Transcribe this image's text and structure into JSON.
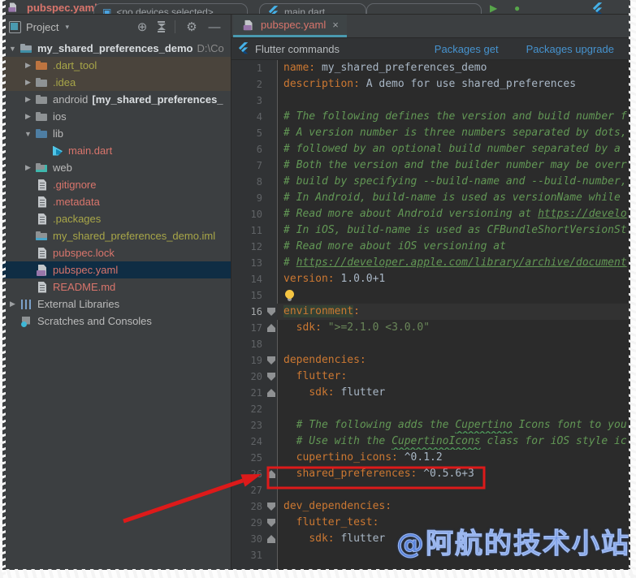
{
  "top_strip": {
    "breadcrumb": "pubspec.yaml",
    "device_selector": "<no devices selected>",
    "run_config": "main.dart",
    "run_glyph": "▶"
  },
  "project_panel": {
    "header": {
      "title": "Project",
      "caret": "▾",
      "target_icon": "⊕",
      "gear_icon": "⚙",
      "hide_icon": "—"
    },
    "tree": [
      {
        "indent": 0,
        "arrow": "down",
        "icon": "folder-project",
        "label": "my_shared_preferences_demo",
        "cls": "root",
        "extra": "D:\\Co"
      },
      {
        "indent": 1,
        "arrow": "right",
        "icon": "folder-excluded",
        "label": ".dart_tool",
        "cls": "olive",
        "tint": true
      },
      {
        "indent": 1,
        "arrow": "right",
        "icon": "folder-idea",
        "label": ".idea",
        "cls": "olive",
        "tint": true
      },
      {
        "indent": 1,
        "arrow": "right",
        "icon": "folder",
        "label": "android",
        "cls": "normal",
        "extraBold": "[my_shared_preferences_"
      },
      {
        "indent": 1,
        "arrow": "right",
        "icon": "folder",
        "label": "ios",
        "cls": "normal"
      },
      {
        "indent": 1,
        "arrow": "down",
        "icon": "folder-lib",
        "label": "lib",
        "cls": "normal"
      },
      {
        "indent": 2,
        "arrow": null,
        "icon": "dart",
        "label": "main.dart",
        "cls": "red"
      },
      {
        "indent": 1,
        "arrow": "right",
        "icon": "folder-web",
        "label": "web",
        "cls": "normal"
      },
      {
        "indent": 1,
        "arrow": null,
        "icon": "file",
        "label": ".gitignore",
        "cls": "red"
      },
      {
        "indent": 1,
        "arrow": null,
        "icon": "file",
        "label": ".metadata",
        "cls": "red"
      },
      {
        "indent": 1,
        "arrow": null,
        "icon": "file",
        "label": ".packages",
        "cls": "olive"
      },
      {
        "indent": 1,
        "arrow": null,
        "icon": "folder-module",
        "label": "my_shared_preferences_demo.iml",
        "cls": "olive"
      },
      {
        "indent": 1,
        "arrow": null,
        "icon": "file",
        "label": "pubspec.lock",
        "cls": "red"
      },
      {
        "indent": 1,
        "arrow": null,
        "icon": "file-yml",
        "label": "pubspec.yaml",
        "cls": "red",
        "selected": true
      },
      {
        "indent": 1,
        "arrow": null,
        "icon": "file",
        "label": "README.md",
        "cls": "red"
      },
      {
        "indent": 0,
        "arrow": "right",
        "icon": "libs",
        "label": "External Libraries",
        "cls": "normal"
      },
      {
        "indent": 0,
        "arrow": null,
        "icon": "scratch",
        "label": "Scratches and Consoles",
        "cls": "normal"
      }
    ]
  },
  "editor": {
    "tab": {
      "label": "pubspec.yaml",
      "close": "×"
    },
    "banner": {
      "title": "Flutter commands",
      "actions": [
        "Packages get",
        "Packages upgrade"
      ]
    },
    "code": {
      "lines": [
        {
          "n": 1,
          "seg": [
            [
              "tk",
              "name:"
            ],
            [
              "tv",
              " my_shared_preferences_demo"
            ]
          ]
        },
        {
          "n": 2,
          "seg": [
            [
              "tk",
              "description:"
            ],
            [
              "tv",
              " A demo for use shared_preferences"
            ]
          ]
        },
        {
          "n": 3,
          "seg": []
        },
        {
          "n": 4,
          "seg": [
            [
              "tc",
              "# The following defines the version and build number f"
            ]
          ]
        },
        {
          "n": 5,
          "seg": [
            [
              "tc",
              "# A version number is three numbers separated by dots,"
            ]
          ]
        },
        {
          "n": 6,
          "seg": [
            [
              "tc",
              "# followed by an optional build number separated by a "
            ]
          ]
        },
        {
          "n": 7,
          "seg": [
            [
              "tc",
              "# Both the version and the builder number may be overr"
            ]
          ]
        },
        {
          "n": 8,
          "seg": [
            [
              "tc",
              "# build by specifying --build-name and --build-number,"
            ]
          ]
        },
        {
          "n": 9,
          "seg": [
            [
              "tc",
              "# In Android, build-name is used as versionName while "
            ]
          ]
        },
        {
          "n": 10,
          "seg": [
            [
              "tc",
              "# Read more about Android versioning at "
            ],
            [
              "tlnk",
              "https://develo"
            ]
          ]
        },
        {
          "n": 11,
          "seg": [
            [
              "tc",
              "# In iOS, build-name is used as CFBundleShortVersionSt"
            ]
          ]
        },
        {
          "n": 12,
          "seg": [
            [
              "tc",
              "# Read more about iOS versioning at"
            ]
          ]
        },
        {
          "n": 13,
          "seg": [
            [
              "tc",
              "# "
            ],
            [
              "tlnk",
              "https://developer.apple.com/library/archive/document"
            ]
          ]
        },
        {
          "n": 14,
          "seg": [
            [
              "tk",
              "version:"
            ],
            [
              "tv",
              " 1.0.0+1"
            ]
          ]
        },
        {
          "n": 15,
          "bulb": true,
          "seg": []
        },
        {
          "n": 16,
          "fold": "start",
          "cur": true,
          "seg": [
            [
              "hlword",
              "environment"
            ],
            [
              "tk",
              ":"
            ]
          ]
        },
        {
          "n": 17,
          "fold": "end",
          "seg": [
            [
              "tv",
              "  "
            ],
            [
              "tk",
              "sdk:"
            ],
            [
              "tv",
              " "
            ],
            [
              "ts",
              "\">=2.1.0 <3.0.0\""
            ]
          ]
        },
        {
          "n": 18,
          "seg": []
        },
        {
          "n": 19,
          "fold": "start",
          "seg": [
            [
              "tk",
              "dependencies:"
            ]
          ]
        },
        {
          "n": 20,
          "fold": "start",
          "seg": [
            [
              "tv",
              "  "
            ],
            [
              "tk",
              "flutter:"
            ]
          ]
        },
        {
          "n": 21,
          "fold": "end",
          "seg": [
            [
              "tv",
              "    "
            ],
            [
              "tk",
              "sdk:"
            ],
            [
              "tv",
              " flutter"
            ]
          ]
        },
        {
          "n": 22,
          "seg": []
        },
        {
          "n": 23,
          "seg": [
            [
              "tv",
              "  "
            ],
            [
              "tc",
              "# The following adds the "
            ],
            [
              "tc wavy",
              "Cupertino"
            ],
            [
              "tc",
              " Icons font to you"
            ]
          ]
        },
        {
          "n": 24,
          "seg": [
            [
              "tv",
              "  "
            ],
            [
              "tc",
              "# Use with the "
            ],
            [
              "tc wavy",
              "CupertinoIcons"
            ],
            [
              "tc",
              " class for iOS style ic"
            ]
          ]
        },
        {
          "n": 25,
          "seg": [
            [
              "tv",
              "  "
            ],
            [
              "tk",
              "cupertino_icons:"
            ],
            [
              "tv",
              " ^0.1.2"
            ]
          ]
        },
        {
          "n": 26,
          "fold": "end",
          "seg": [
            [
              "tv",
              "  "
            ],
            [
              "tk",
              "shared_preferences:"
            ],
            [
              "tv",
              " ^0.5.6+3"
            ]
          ]
        },
        {
          "n": 27,
          "seg": []
        },
        {
          "n": 28,
          "fold": "start",
          "seg": [
            [
              "tk",
              "dev_dependencies:"
            ]
          ]
        },
        {
          "n": 29,
          "fold": "start",
          "seg": [
            [
              "tv",
              "  "
            ],
            [
              "tk",
              "flutter_test:"
            ]
          ]
        },
        {
          "n": 30,
          "fold": "end",
          "seg": [
            [
              "tv",
              "    "
            ],
            [
              "tk",
              "sdk:"
            ],
            [
              "tv",
              " flutter"
            ]
          ]
        },
        {
          "n": 31,
          "seg": []
        }
      ]
    }
  },
  "annotations": {
    "color": "#dd1a1a"
  },
  "watermark": {
    "text": "@阿航的技术小站"
  }
}
